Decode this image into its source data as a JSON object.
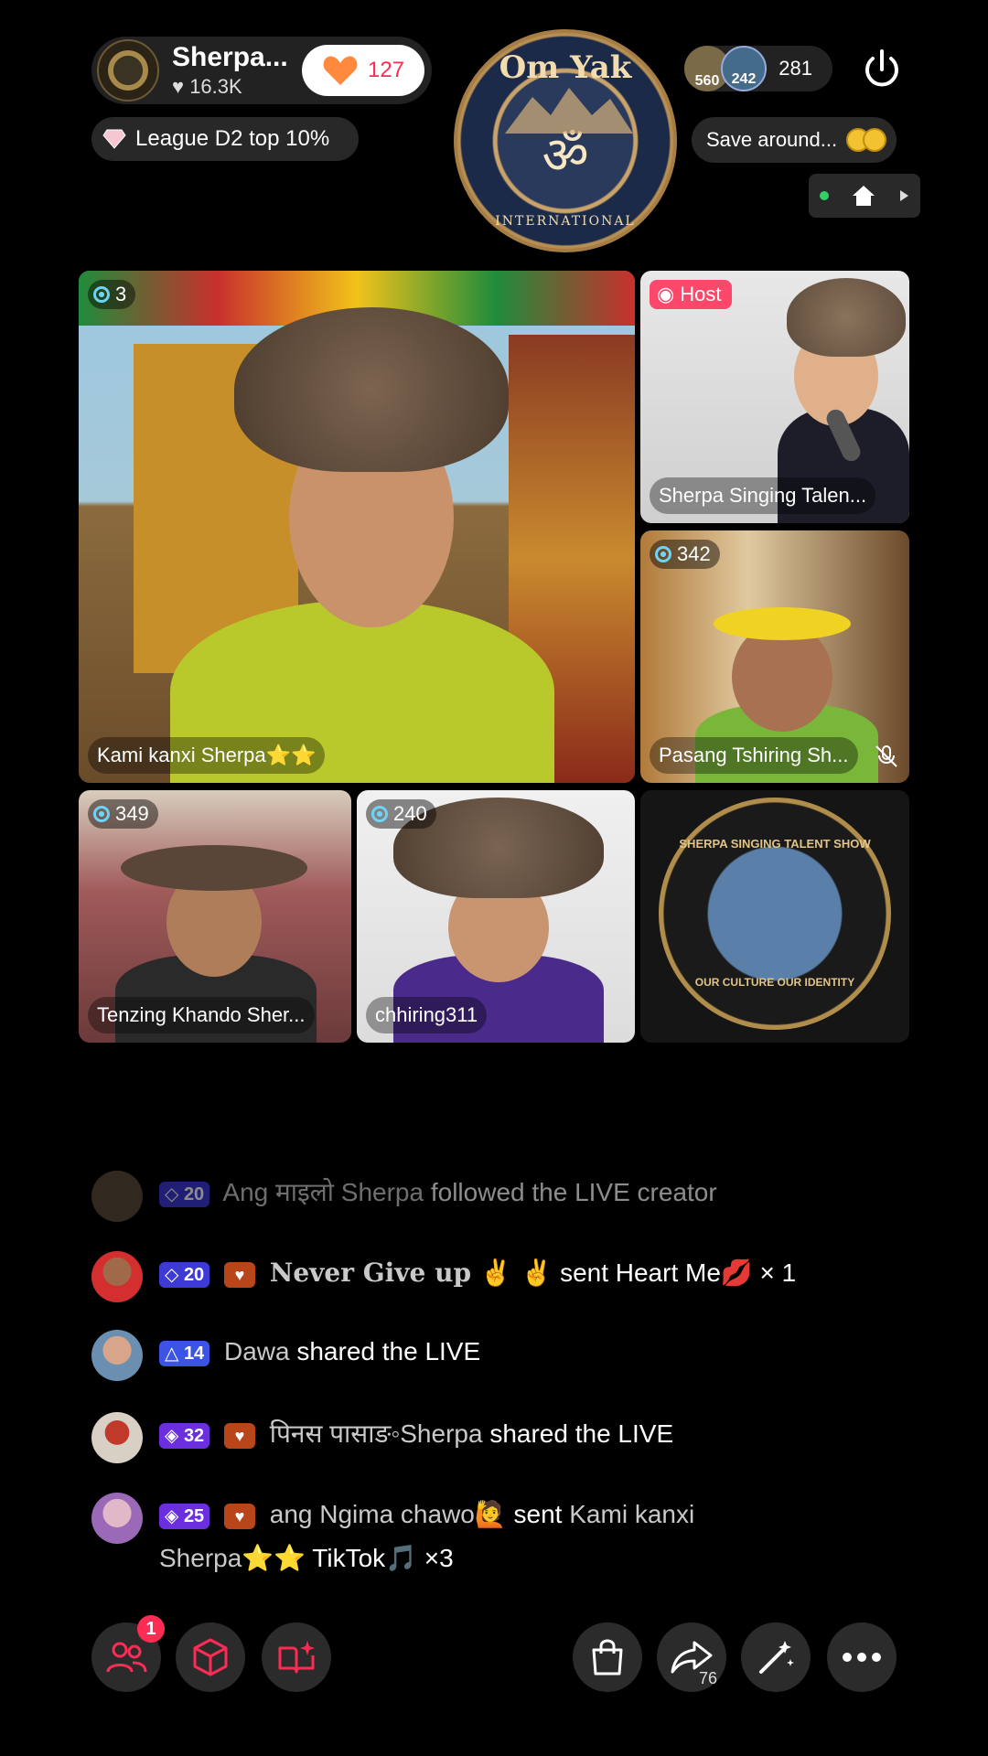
{
  "header": {
    "creator_name": "Sherpa...",
    "creator_likes": "16.3K",
    "like_count": "127",
    "league_label": "League D2 top 10%",
    "viewer_avatar_1": "560",
    "viewer_avatar_2": "242",
    "viewer_count": "281",
    "save_label": "Save around..."
  },
  "logo": {
    "top_text": "Om Yak",
    "bottom_text": "INTERNATIONAL",
    "symbol": "ॐ"
  },
  "tiles": {
    "main": {
      "badge": "3",
      "name": "Kami kanxi Sherpa⭐⭐"
    },
    "host": {
      "badge": "Host",
      "name": "Sherpa Singing Talen..."
    },
    "guest2": {
      "badge": "342",
      "name": "Pasang Tshiring Sh..."
    },
    "guest3": {
      "badge": "349",
      "name": "Tenzing Khando Sher..."
    },
    "guest4": {
      "badge": "240",
      "name": "chhiring311"
    },
    "show_logo": {
      "top_text": "SHERPA SINGING TALENT SHOW",
      "bottom_text": "OUR CULTURE OUR IDENTITY"
    }
  },
  "chat": [
    {
      "level": "20",
      "user": "Ang माइलो Sherpa",
      "action": "followed the LIVE creator",
      "heart": false
    },
    {
      "level": "20",
      "user": "Never Give up ✌️ ✌️",
      "action": "sent Heart Me💋 × 1",
      "heart": true
    },
    {
      "level": "14",
      "user": "Dawa",
      "action": "shared the LIVE",
      "heart": false
    },
    {
      "level": "32",
      "user": "पिनस पासाङ◦Sherpa",
      "action": "shared the LIVE",
      "heart": true
    },
    {
      "level": "25",
      "user": "ang Ngima chawo🙋",
      "action": "sent",
      "target": "Kami kanxi Sherpa⭐⭐",
      "gift": "TikTok🎵 ×3",
      "heart": true
    }
  ],
  "bottom_bar": {
    "notification_count": "1",
    "share_count": "76"
  },
  "colors": {
    "accent": "#fe2c55",
    "level_badge": "#3d3ad6",
    "host_badge": "#fe2c55"
  }
}
